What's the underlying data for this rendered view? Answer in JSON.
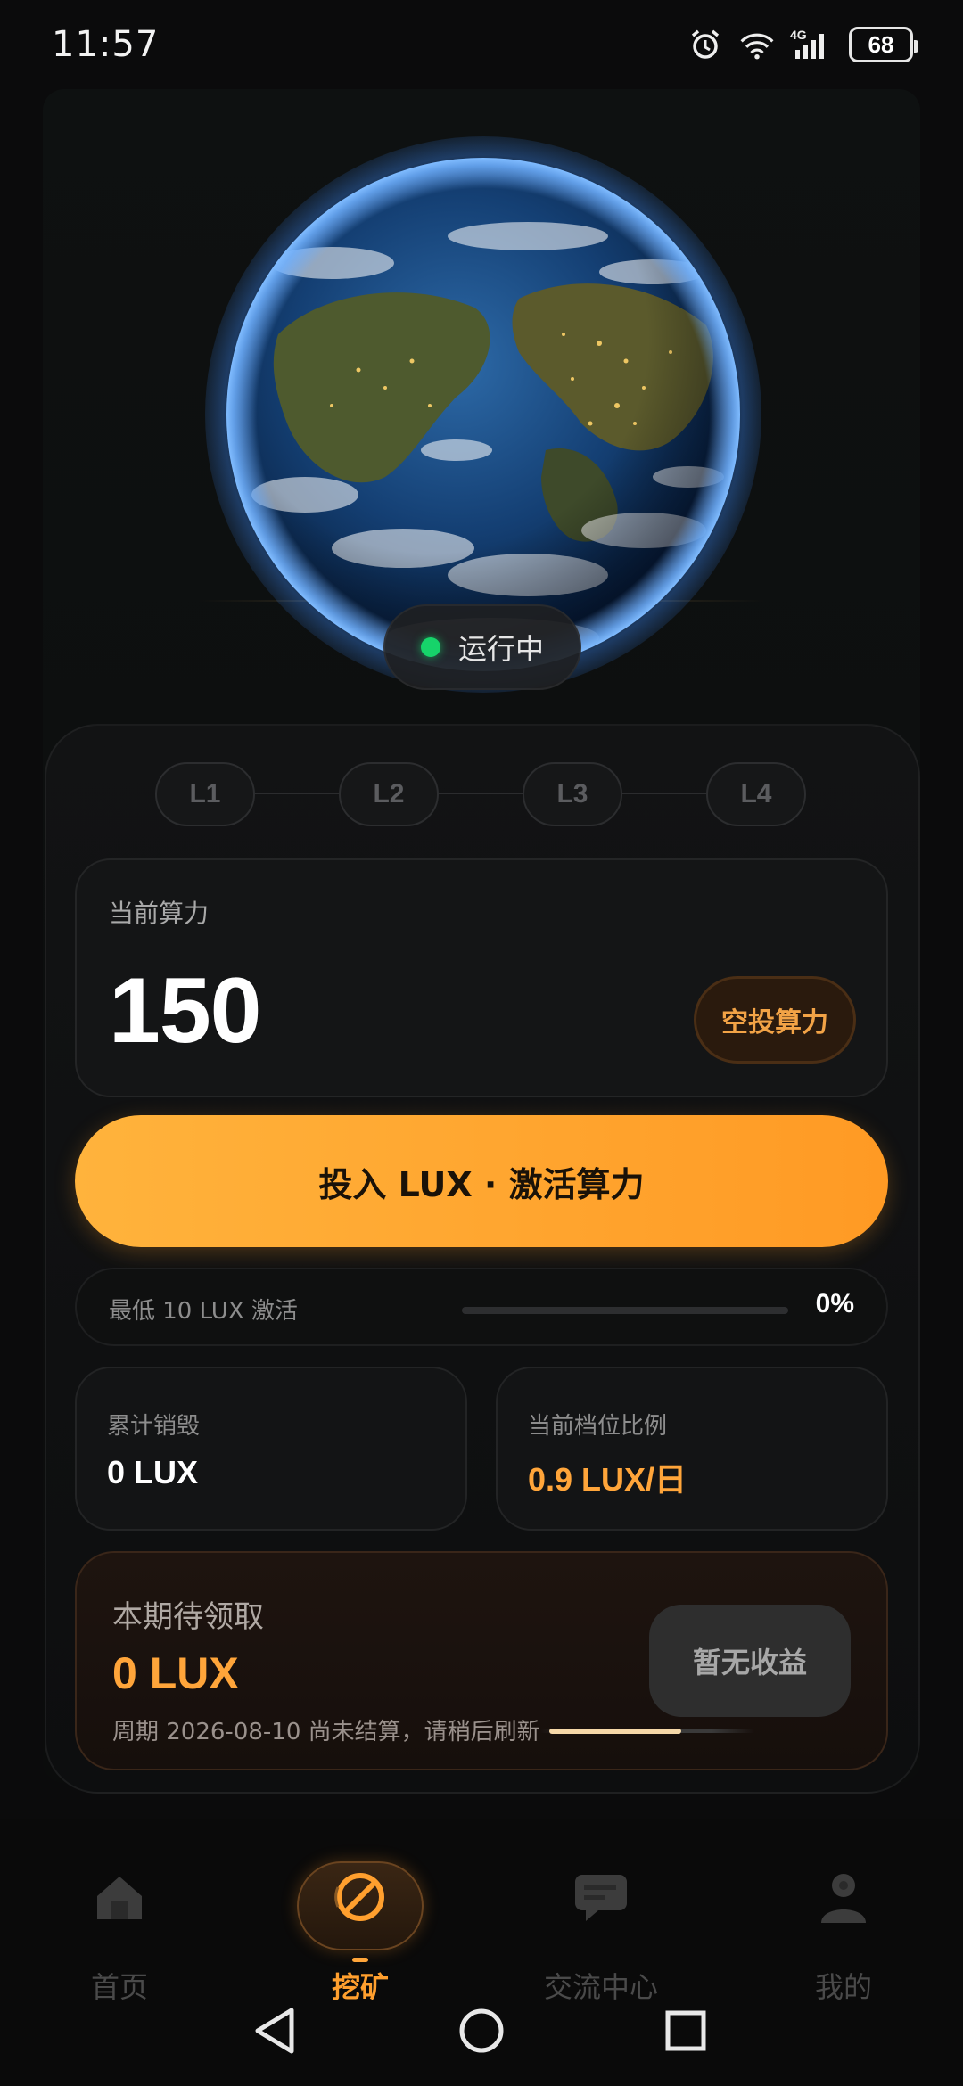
{
  "status_bar": {
    "time": "11:57",
    "battery": "68",
    "network": "4G",
    "icons": [
      "alarm-icon",
      "wifi-icon",
      "signal-icon",
      "battery-icon"
    ]
  },
  "mining": {
    "status_text": "运行中",
    "status_color": "#16d46a",
    "levels": [
      "L1",
      "L2",
      "L3",
      "L4"
    ],
    "power_label": "当前算力",
    "power_value": "150",
    "airdrop_button": "空投算力",
    "activate_button": "投入 LUX · 激活算力",
    "min_activate_label": "最低 10 LUX 激活",
    "progress_percent": "0%",
    "progress_fraction": 0,
    "stats": {
      "burned_label": "累计销毁",
      "burned_value": "0 LUX",
      "ratio_label": "当前档位比例",
      "ratio_value": "0.9 LUX/日"
    },
    "reward": {
      "label": "本期待领取",
      "value": "0 LUX",
      "note": "周期 2026-08-10 尚未结算，请稍后刷新",
      "button": "暂无收益"
    }
  },
  "bottom_nav": {
    "items": [
      {
        "label": "首页",
        "icon": "home-icon"
      },
      {
        "label": "挖矿",
        "icon": "mining-icon"
      },
      {
        "label": "交流中心",
        "icon": "chat-icon"
      },
      {
        "label": "我的",
        "icon": "profile-icon"
      }
    ],
    "active_index": 1
  },
  "colors": {
    "accent": "#ffa42e",
    "active_nav": "#ff9f2e",
    "background": "#0b0b0c"
  }
}
